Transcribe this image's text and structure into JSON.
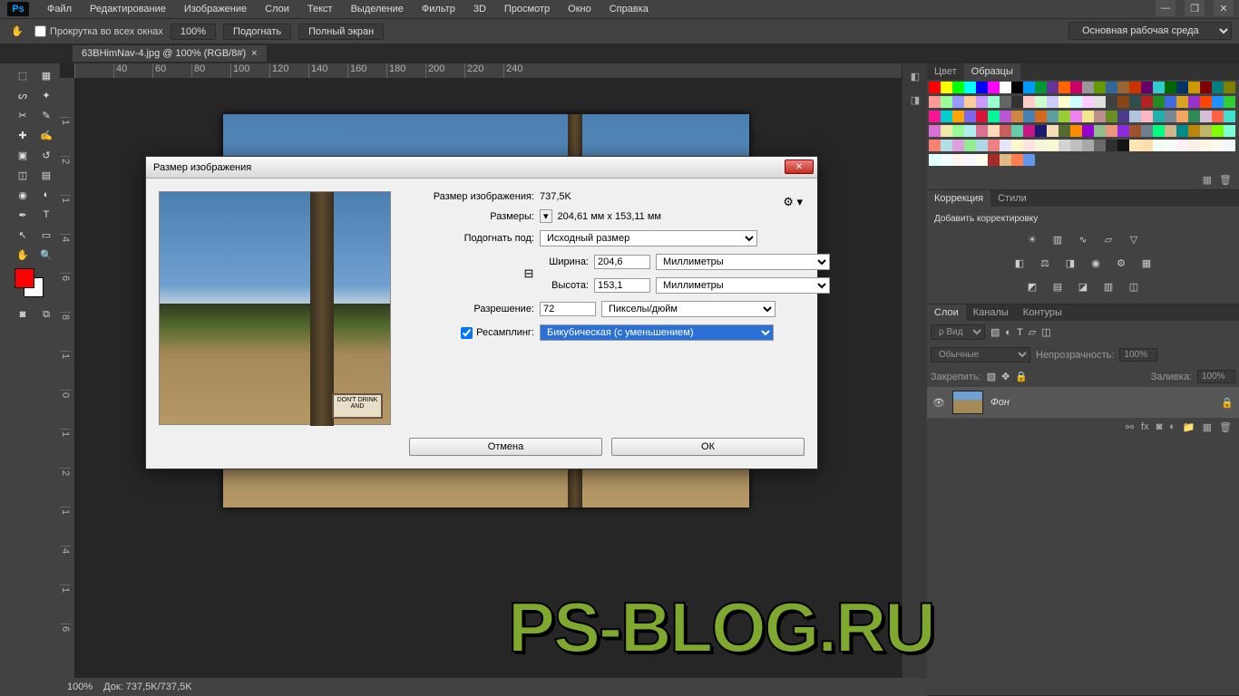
{
  "app": {
    "logo": "Ps"
  },
  "menu": [
    "Файл",
    "Редактирование",
    "Изображение",
    "Слои",
    "Текст",
    "Выделение",
    "Фильтр",
    "3D",
    "Просмотр",
    "Окно",
    "Справка"
  ],
  "optbar": {
    "scroll_all": "Прокрутка во всех окнах",
    "zoom": "100%",
    "fit": "Подогнать",
    "fullscreen": "Полный экран",
    "workspace": "Основная рабочая среда"
  },
  "document": {
    "tab": "63BHimNav-4.jpg @ 100% (RGB/8#)",
    "sign_text": "DON'T\nDRINK AND\nDRIVE"
  },
  "ruler_h": [
    "",
    "40",
    "60",
    "80",
    "100",
    "120",
    "140",
    "160",
    "180",
    "200",
    "220",
    "240"
  ],
  "ruler_v": [
    "",
    "1",
    "2",
    "1",
    "4",
    "6",
    "8",
    "1",
    "0",
    "1",
    "2",
    "1",
    "4",
    "1",
    "6"
  ],
  "dialog": {
    "title": "Размер изображения",
    "size_label": "Размер изображения:",
    "size_value": "737,5K",
    "dims_label": "Размеры:",
    "dims_value": "204,61 мм x 153,11 мм",
    "fit_label": "Подогнать под:",
    "fit_value": "Исходный размер",
    "width_label": "Ширина:",
    "width_value": "204,6",
    "height_label": "Высота:",
    "height_value": "153,1",
    "unit_mm": "Миллиметры",
    "res_label": "Разрешение:",
    "res_value": "72",
    "res_unit": "Пикселы/дюйм",
    "resample_label": "Ресамплинг:",
    "resample_value": "Бикубическая (с уменьшением)",
    "ok": "ОК",
    "cancel": "Отмена",
    "preview_sign": "DON'T\nDRINK AND"
  },
  "panels": {
    "color_tabs": [
      "Цвет",
      "Образцы"
    ],
    "adjust_tabs": [
      "Коррекция",
      "Стили"
    ],
    "adjust_hint": "Добавить корректировку",
    "layer_tabs": [
      "Слои",
      "Каналы",
      "Контуры"
    ],
    "layer_kind": "ρ Вид",
    "blend": "Обычные",
    "opacity_label": "Непрозрачность:",
    "opacity": "100%",
    "lock_label": "Закрепить:",
    "fill_label": "Заливка:",
    "fill": "100%",
    "layer_name": "Фон"
  },
  "status": {
    "zoom": "100%",
    "docsize": "Док: 737,5K/737,5K"
  },
  "watermark": "PS-BLOG.RU",
  "swatch_colors": [
    "#ff0000",
    "#ffff00",
    "#00ff00",
    "#00ffff",
    "#0000ff",
    "#ff00ff",
    "#ffffff",
    "#000000",
    "#0099ff",
    "#009933",
    "#663399",
    "#ff6600",
    "#cc0066",
    "#999999",
    "#669900",
    "#336699",
    "#996633",
    "#cc3300",
    "#660066",
    "#33cccc",
    "#006600",
    "#003366",
    "#cc9900",
    "#800000",
    "#008080",
    "#808000",
    "#ff9999",
    "#99ff99",
    "#9999ff",
    "#ffcc99",
    "#cc99ff",
    "#99ffcc",
    "#666666",
    "#333333",
    "#ffcccc",
    "#ccffcc",
    "#ccccff",
    "#ffffcc",
    "#ccffff",
    "#ffccff",
    "#e0e0e0",
    "#404040",
    "#8b4513",
    "#2f4f4f",
    "#b22222",
    "#228b22",
    "#4169e1",
    "#daa520",
    "#9932cc",
    "#ff4500",
    "#1e90ff",
    "#32cd32",
    "#ff1493",
    "#00ced1",
    "#ffa500",
    "#7b68ee",
    "#dc143c",
    "#00fa9a",
    "#ba55d3",
    "#cd853f",
    "#4682b4",
    "#d2691e",
    "#5f9ea0",
    "#9acd32",
    "#ee82ee",
    "#f0e68c",
    "#bc8f8f",
    "#6b8e23",
    "#483d8b",
    "#b0c4de",
    "#ffb6c1",
    "#20b2aa",
    "#778899",
    "#f4a460",
    "#2e8b57",
    "#d8bfd8",
    "#ff6347",
    "#40e0d0",
    "#da70d6",
    "#eee8aa",
    "#98fb98",
    "#afeeee",
    "#db7093",
    "#ffdab9",
    "#cd5c5c",
    "#66cdaa",
    "#c71585",
    "#191970",
    "#f5deb3",
    "#556b2f",
    "#ff8c00",
    "#9400d3",
    "#8fbc8f",
    "#e9967a",
    "#8a2be2",
    "#a0522d",
    "#708090",
    "#00ff7f",
    "#d2b48c",
    "#008b8b",
    "#b8860b",
    "#bdb76b",
    "#7fff00",
    "#7fffd4",
    "#fa8072",
    "#b0e0e6",
    "#dda0dd",
    "#90ee90",
    "#add8e6",
    "#f08080",
    "#e6e6fa",
    "#fffacd",
    "#ffe4e1",
    "#f5f5dc",
    "#fafad2",
    "#d3d3d3",
    "#c0c0c0",
    "#a9a9a9",
    "#696969",
    "#2f2f2f",
    "#151515",
    "#ffe4b5",
    "#ffdead",
    "#f0fff0",
    "#f5fffa",
    "#fff0f5",
    "#faf0e6",
    "#fdf5e6",
    "#fffaf0",
    "#f0f8ff",
    "#e0ffff",
    "#f0ffff",
    "#fff5ee",
    "#f8f8ff",
    "#fffff0",
    "#a52a2a",
    "#deb887",
    "#ff7f50",
    "#6495ed"
  ]
}
